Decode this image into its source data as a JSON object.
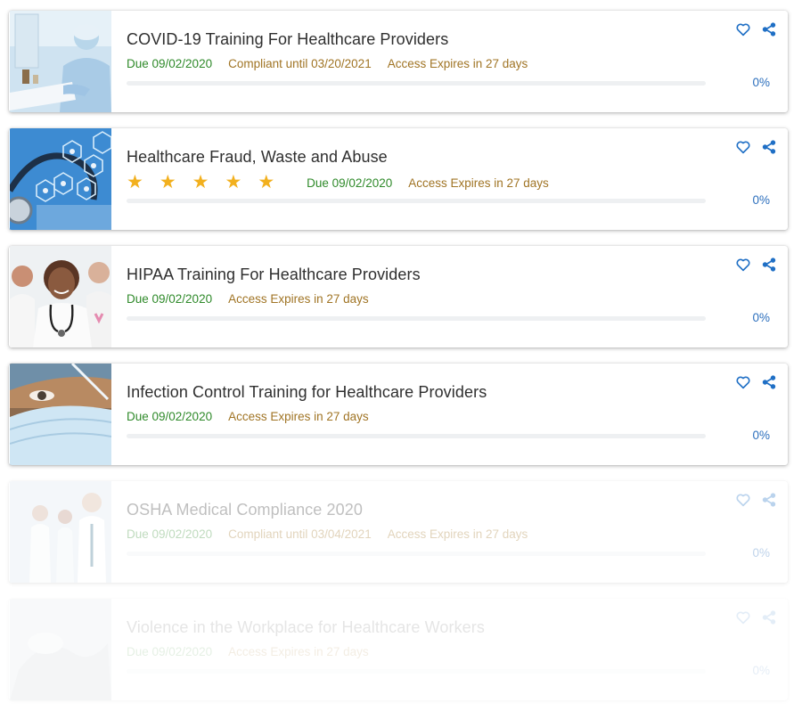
{
  "courses": [
    {
      "title": "COVID-19 Training For Healthcare Providers",
      "rating": null,
      "due": "Due 09/02/2020",
      "compliant": "Compliant until 03/20/2021",
      "expires": "Access Expires in 27 days",
      "progress": "0%",
      "progress_fraction": 0,
      "image": "covid-ppe-photo"
    },
    {
      "title": "Healthcare Fraud, Waste and Abuse",
      "rating": 5,
      "due": "Due 09/02/2020",
      "compliant": "",
      "expires": "Access Expires in 27 days",
      "progress": "0%",
      "progress_fraction": 0,
      "image": "stethoscope-hexagon-photo"
    },
    {
      "title": "HIPAA Training For Healthcare Providers",
      "rating": null,
      "due": "Due 09/02/2020",
      "compliant": "",
      "expires": "Access Expires in 27 days",
      "progress": "0%",
      "progress_fraction": 0,
      "image": "doctor-team-photo"
    },
    {
      "title": "Infection Control Training for Healthcare Providers",
      "rating": null,
      "due": "Due 09/02/2020",
      "compliant": "",
      "expires": "Access Expires in 27 days",
      "progress": "0%",
      "progress_fraction": 0,
      "image": "surgical-mask-photo"
    },
    {
      "title": "OSHA Medical Compliance 2020",
      "rating": null,
      "due": "Due 09/02/2020",
      "compliant": "Compliant until 03/04/2021",
      "expires": "Access Expires in 27 days",
      "progress": "0%",
      "progress_fraction": 0,
      "image": "medical-staff-photo"
    },
    {
      "title": "Violence in the Workplace for Healthcare Workers",
      "rating": null,
      "due": "Due 09/02/2020",
      "compliant": "",
      "expires": "Access Expires in 27 days",
      "progress": "0%",
      "progress_fraction": 0,
      "image": "hands-photo"
    }
  ],
  "icons": {
    "favorite": "heart-outline-icon",
    "share": "share-icon",
    "rating": "star-icon"
  },
  "colors": {
    "due": "#2f8a2a",
    "compliant": "#a07424",
    "expires": "#a07424",
    "progress_text": "#2c6fbd",
    "icon": "#1f6fc5",
    "star": "#f2b01e"
  }
}
